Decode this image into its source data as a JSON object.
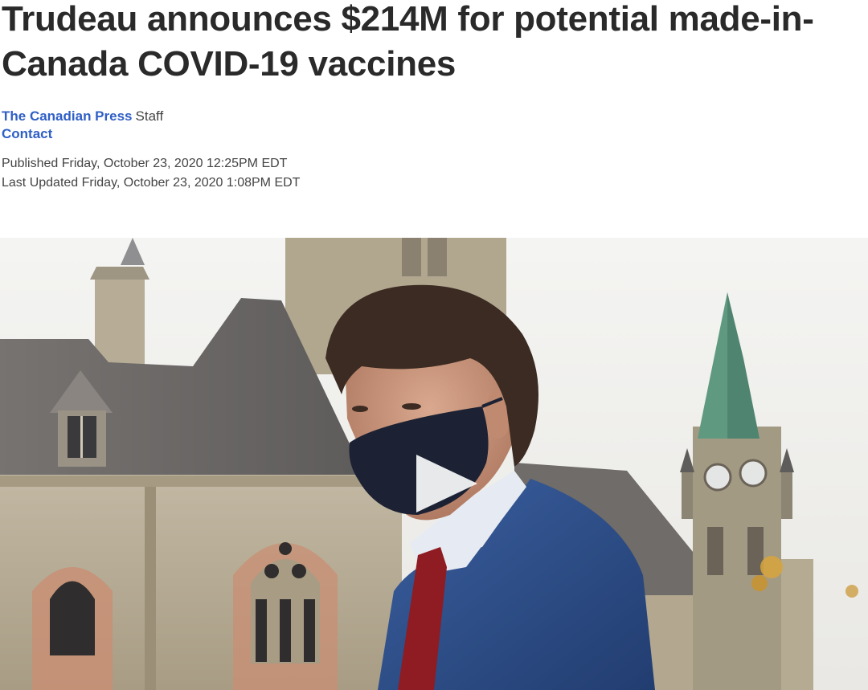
{
  "article": {
    "headline": "Trudeau announces $214M for potential made-in-Canada COVID-19 vaccines",
    "byline": {
      "author": "The Canadian Press",
      "role": "Staff",
      "contact": "Contact"
    },
    "published": "Published Friday, October 23, 2020 12:25PM EDT",
    "updated": "Last Updated Friday, October 23, 2020 1:08PM EDT"
  },
  "media": {
    "type": "video",
    "play_icon": "play-icon",
    "colors": {
      "sky": "#f2f2f0",
      "stone": "#b8ad96",
      "roof": "#6f6d6b",
      "copper_roof": "#5f9a80",
      "mask": "#1c2233",
      "suit": "#2e4f8c",
      "tie": "#8f1c22"
    }
  },
  "colors": {
    "link": "#2f5fc6",
    "headline": "#2a2a2a",
    "meta": "#444444"
  }
}
